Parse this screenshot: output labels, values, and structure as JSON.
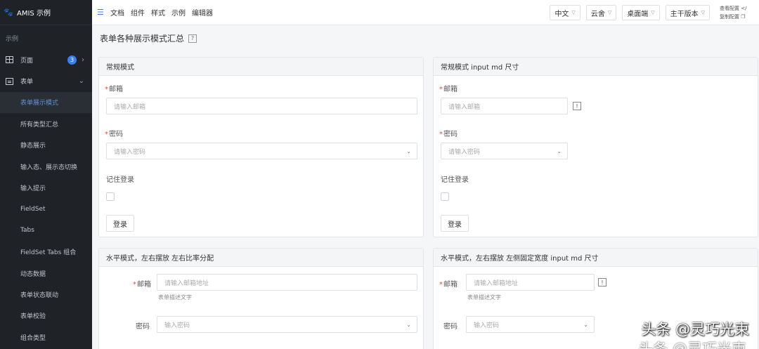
{
  "sidebar": {
    "brand": "AMIS 示例",
    "section": "示例",
    "items": [
      {
        "label": "页面",
        "badge": "3"
      },
      {
        "label": "表单"
      }
    ],
    "sub_items": [
      "表单展示模式",
      "所有类型汇总",
      "静态展示",
      "输入态、展示态切换",
      "输入提示",
      "FieldSet",
      "Tabs",
      "FieldSet Tabs 组合",
      "动态数据",
      "表单状态联动",
      "表单校验",
      "组合类型"
    ],
    "active_index": 0
  },
  "topbar": {
    "links": [
      "文档",
      "组件",
      "样式",
      "示例",
      "编辑器"
    ],
    "dropdowns": [
      "中文",
      "云舍",
      "桌面端",
      "主干版本"
    ],
    "tools": [
      "查看配置",
      "复制配置"
    ]
  },
  "page": {
    "title": "表单各种展示模式汇总",
    "help": "?"
  },
  "panels": {
    "normal": {
      "title": "常规模式",
      "email_label": "邮箱",
      "email_placeholder": "请输入邮箱",
      "password_label": "密码",
      "password_placeholder": "请输入密码",
      "remember_label": "记住登录",
      "submit": "登录"
    },
    "normal_md": {
      "title": "常规模式 input md 尺寸",
      "email_label": "邮箱",
      "email_placeholder": "请输入邮箱",
      "password_label": "密码",
      "password_placeholder": "请输入密码",
      "remember_label": "记住登录",
      "submit": "登录"
    },
    "horizontal": {
      "title": "水平模式，左右摆放 左右比率分配",
      "email_label": "邮箱",
      "email_placeholder": "请输入邮箱地址",
      "email_desc": "表单描述文字",
      "password_label": "密码",
      "password_placeholder": "输入密码"
    },
    "horizontal_md": {
      "title": "水平模式，左右摆放 左侧固定宽度 input md 尺寸",
      "email_label": "邮箱",
      "email_placeholder": "请输入邮箱地址",
      "email_desc": "表单描述文字",
      "password_label": "密码",
      "password_placeholder": "输入密码"
    }
  },
  "watermark": {
    "line1": "头条 @灵巧光束",
    "line2": "头条 @灵巧光束"
  },
  "colors": {
    "sidebar_bg": "#1f2328",
    "accent": "#3a7ff2",
    "required": "#e74c3c"
  }
}
